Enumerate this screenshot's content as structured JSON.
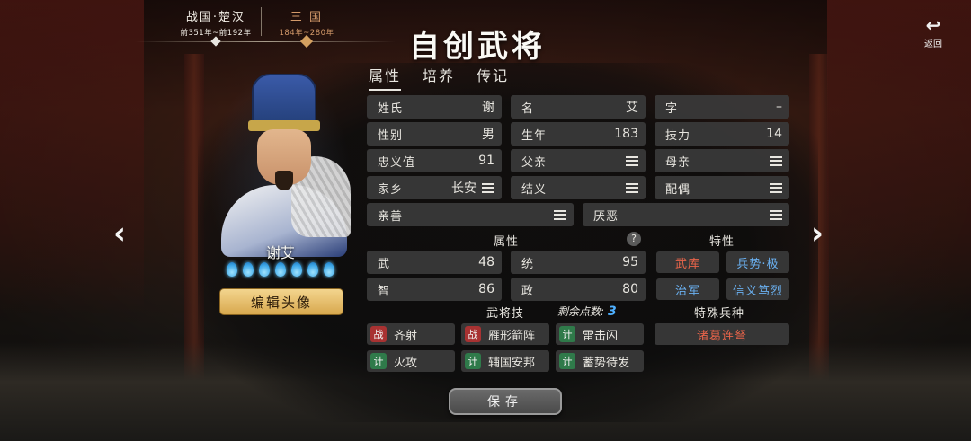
{
  "eras": [
    {
      "name": "战国·楚汉",
      "years": "前351年~前192年"
    },
    {
      "name": "三 国",
      "years": "184年~280年"
    }
  ],
  "title": "自创武将",
  "back_label": "返回",
  "tabs": [
    "属性",
    "培养",
    "传记"
  ],
  "character": {
    "name": "谢艾",
    "potential_drops": 7
  },
  "edit_portrait_label": "编辑头像",
  "fields": {
    "surname": {
      "label": "姓氏",
      "value": "谢"
    },
    "given_name": {
      "label": "名",
      "value": "艾"
    },
    "courtesy": {
      "label": "字",
      "value": "–"
    },
    "gender": {
      "label": "性别",
      "value": "男"
    },
    "birth_year": {
      "label": "生年",
      "value": "183"
    },
    "skill_power": {
      "label": "技力",
      "value": "14"
    },
    "loyalty": {
      "label": "忠义值",
      "value": "91"
    },
    "father": {
      "label": "父亲"
    },
    "mother": {
      "label": "母亲"
    },
    "hometown": {
      "label": "家乡",
      "value": "长安"
    },
    "sworn": {
      "label": "结义"
    },
    "spouse": {
      "label": "配偶"
    },
    "friendly": {
      "label": "亲善"
    },
    "hostile": {
      "label": "厌恶"
    }
  },
  "attributes_header": "属性",
  "help_icon": "?",
  "attributes": {
    "wu": {
      "label": "武",
      "value": "48"
    },
    "tong": {
      "label": "统",
      "value": "95"
    },
    "zhi": {
      "label": "智",
      "value": "86"
    },
    "zheng": {
      "label": "政",
      "value": "80"
    }
  },
  "traits_header": "特性",
  "traits": [
    {
      "label": "武库",
      "color": "red"
    },
    {
      "label": "兵势·极",
      "color": "blue"
    },
    {
      "label": "治军",
      "color": "blue"
    },
    {
      "label": "信义笃烈",
      "color": "blue"
    }
  ],
  "skills_header": "武将技",
  "remaining_points_label": "剩余点数:",
  "remaining_points": "3",
  "special_unit_header": "特殊兵种",
  "special_unit": "诸葛连弩",
  "skills": [
    {
      "type": "战",
      "name": "齐射"
    },
    {
      "type": "战",
      "name": "雁形箭阵"
    },
    {
      "type": "计",
      "name": "雷击闪"
    },
    {
      "type": "计",
      "name": "火攻"
    },
    {
      "type": "计",
      "name": "辅国安邦"
    },
    {
      "type": "计",
      "name": "蓄势待发"
    }
  ],
  "save_label": "保存",
  "colors": {
    "accent_gold": "#d8a84e",
    "red_trait": "#e8644a",
    "blue_trait": "#6ab0f0",
    "points": "#4fb0ff"
  }
}
